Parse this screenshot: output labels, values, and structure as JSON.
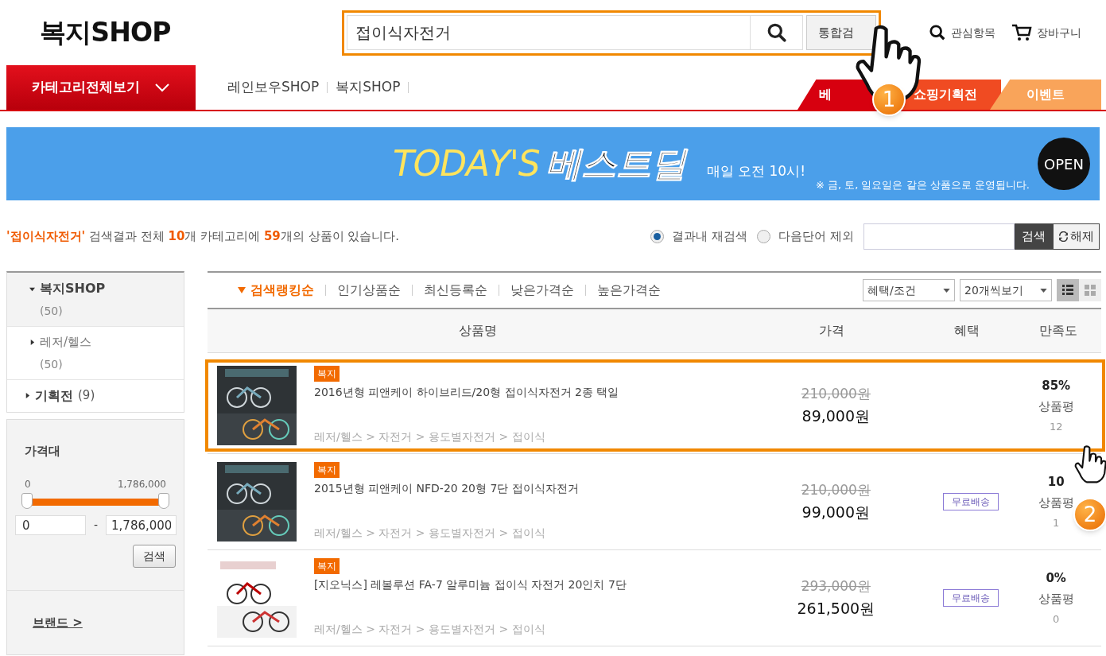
{
  "header": {
    "logo": "복지SHOP",
    "search": {
      "value": "접이식자전거",
      "button": "통합검"
    },
    "links": [
      {
        "label": "관심항목",
        "kind": "search"
      },
      {
        "label": "장바구니",
        "kind": "cart"
      }
    ]
  },
  "nav": {
    "category_button": "카테고리전체보기",
    "links": [
      "레인보우SHOP",
      "복지SHOP"
    ],
    "tabs": [
      {
        "label": "베",
        "color": "#d7000f"
      },
      {
        "label": "쇼핑기획전",
        "color": "#f04b22"
      },
      {
        "label": "이벤트",
        "color": "#f9a45a"
      }
    ]
  },
  "banner": {
    "title": "TODAY'S",
    "title_bold": "베스트딜",
    "subtitle": "매일 오전 10시!",
    "note": "※ 금, 토, 일요일은 같은 상품으로 운영됩니다.",
    "button": "OPEN"
  },
  "summary": [
    {
      "text": "'접이식자전거'",
      "highlight": true
    },
    {
      "text": " 검색결과 전체 ",
      "highlight": false
    },
    {
      "text": "10",
      "highlight": true
    },
    {
      "text": "개 카테고리에 ",
      "highlight": false
    },
    {
      "text": "59",
      "highlight": true
    },
    {
      "text": "개의 상품이 있습니다.",
      "highlight": false
    }
  ],
  "research": {
    "options": [
      {
        "label": "결과내 재검색",
        "selected": true
      },
      {
        "label": "다음단어 제외",
        "selected": false
      }
    ],
    "search_button": "검색",
    "reset_button": "해제"
  },
  "sidebar": {
    "categories": [
      {
        "label": "복지SHOP",
        "count": "(50)",
        "kind": "block",
        "expanded": true,
        "children": [
          {
            "label": "레저/헬스",
            "count": "(50)",
            "kind": "block",
            "expanded": false
          }
        ]
      },
      {
        "label": "기획전",
        "count": "(9)",
        "kind": "inline",
        "expanded": false
      }
    ],
    "price_filter": {
      "title": "가격대",
      "min_label": "0",
      "max_label": "1,786,000",
      "level": 1,
      "min": "0",
      "separator": "-",
      "max": "1,786,000",
      "button": "검색"
    },
    "brand": "브랜드 >"
  },
  "sort": {
    "options": [
      {
        "label": "검색랭킹순",
        "selected": true
      },
      {
        "label": "인기상품순",
        "selected": false
      },
      {
        "label": "최신등록순",
        "selected": false
      },
      {
        "label": "낮은가격순",
        "selected": false
      },
      {
        "label": "높은가격순",
        "selected": false
      }
    ],
    "selects": [
      "혜택/조건",
      "20개씩보기"
    ],
    "views": [
      {
        "kind": "list",
        "selected": true
      },
      {
        "kind": "grid",
        "selected": false
      }
    ]
  },
  "table": {
    "columns": [
      "상품명",
      "가격",
      "혜택",
      "만족도"
    ],
    "rows": [
      {
        "badge": "복지",
        "name": "2016년형 피앤케이 하이브리드/20형 접이식자전거 2종 택일",
        "path": "레저/헬스 > 자전거 > 용도별자전거 > 접이식",
        "original_price": "210,000원",
        "price": "89,000원",
        "rating": "85%",
        "rating_label": "상품평",
        "review_count": "12",
        "highlighted": true
      },
      {
        "badge": "복지",
        "name": "2015년형 피앤케이 NFD-20 20형 7단 접이식자전거",
        "path": "레저/헬스 > 자전거 > 용도별자전거 > 접이식",
        "original_price": "210,000원",
        "price": "99,000원",
        "benefit": "무료배송",
        "rating": "10",
        "rating_label": "상품평",
        "review_count": "1",
        "highlighted": false
      },
      {
        "badge": "복지",
        "name": "[지오닉스] 레볼루션 FA-7 알루미늄 접이식 자전거 20인치 7단",
        "path": "레저/헬스 > 자전거 > 용도별자전거 > 접이식",
        "original_price": "293,000원",
        "price": "261,500원",
        "benefit": "무료배송",
        "rating": "0%",
        "rating_label": "상품평",
        "review_count": "0",
        "highlighted": false
      }
    ]
  },
  "annotations": [
    {
      "number": "1"
    },
    {
      "number": "2"
    }
  ]
}
